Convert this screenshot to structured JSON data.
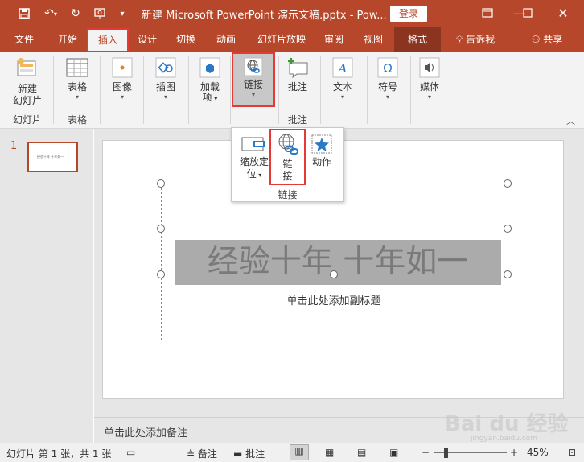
{
  "titlebar": {
    "title": "新建 Microsoft PowerPoint 演示文稿.pptx  -  Pow...",
    "login_label": "登录",
    "save_icon": "save-icon",
    "undo_icon": "undo-icon",
    "redo_icon": "redo-icon",
    "customize_icon": "customize-qat-icon"
  },
  "tabs": {
    "file": "文件",
    "home": "开始",
    "insert": "插入",
    "design": "设计",
    "transitions": "切换",
    "animations": "动画",
    "slideshow": "幻灯片放映",
    "review": "审阅",
    "view": "视图",
    "format": "格式",
    "tell_me": "告诉我",
    "share": "共享"
  },
  "ribbon": {
    "new_slide_line1": "新建",
    "new_slide_line2": "幻灯片",
    "slides_group": "幻灯片",
    "table": "表格",
    "tables_group": "表格",
    "images": "图像",
    "illustrations": "插图",
    "addins_line1": "加载",
    "addins_line2": "项",
    "links": "链接",
    "comment": "批注",
    "comments_group": "批注",
    "text": "文本",
    "symbols": "符号",
    "media": "媒体"
  },
  "dropdown": {
    "zoom_line1": "缩放定",
    "zoom_line2": "位",
    "link_line1": "链",
    "link_line2": "接",
    "action": "动作",
    "group_label": "链接"
  },
  "slide_pane": {
    "slide_number": "1",
    "thumb_text": "经验十年 十年如一"
  },
  "slide": {
    "title": "经验十年 十年如一",
    "subtitle": "单击此处添加副标题"
  },
  "notes": {
    "placeholder": "单击此处添加备注"
  },
  "statusbar": {
    "slide_info": "幻灯片 第 1 张，共 1 张",
    "notes_label": "备注",
    "comments_label": "批注",
    "zoom_level": "45%"
  },
  "watermark": {
    "text": "Bai du 经验",
    "url": "jingyan.baidu.com"
  },
  "colors": {
    "accent": "#b7472a",
    "highlight": "#e53935"
  }
}
